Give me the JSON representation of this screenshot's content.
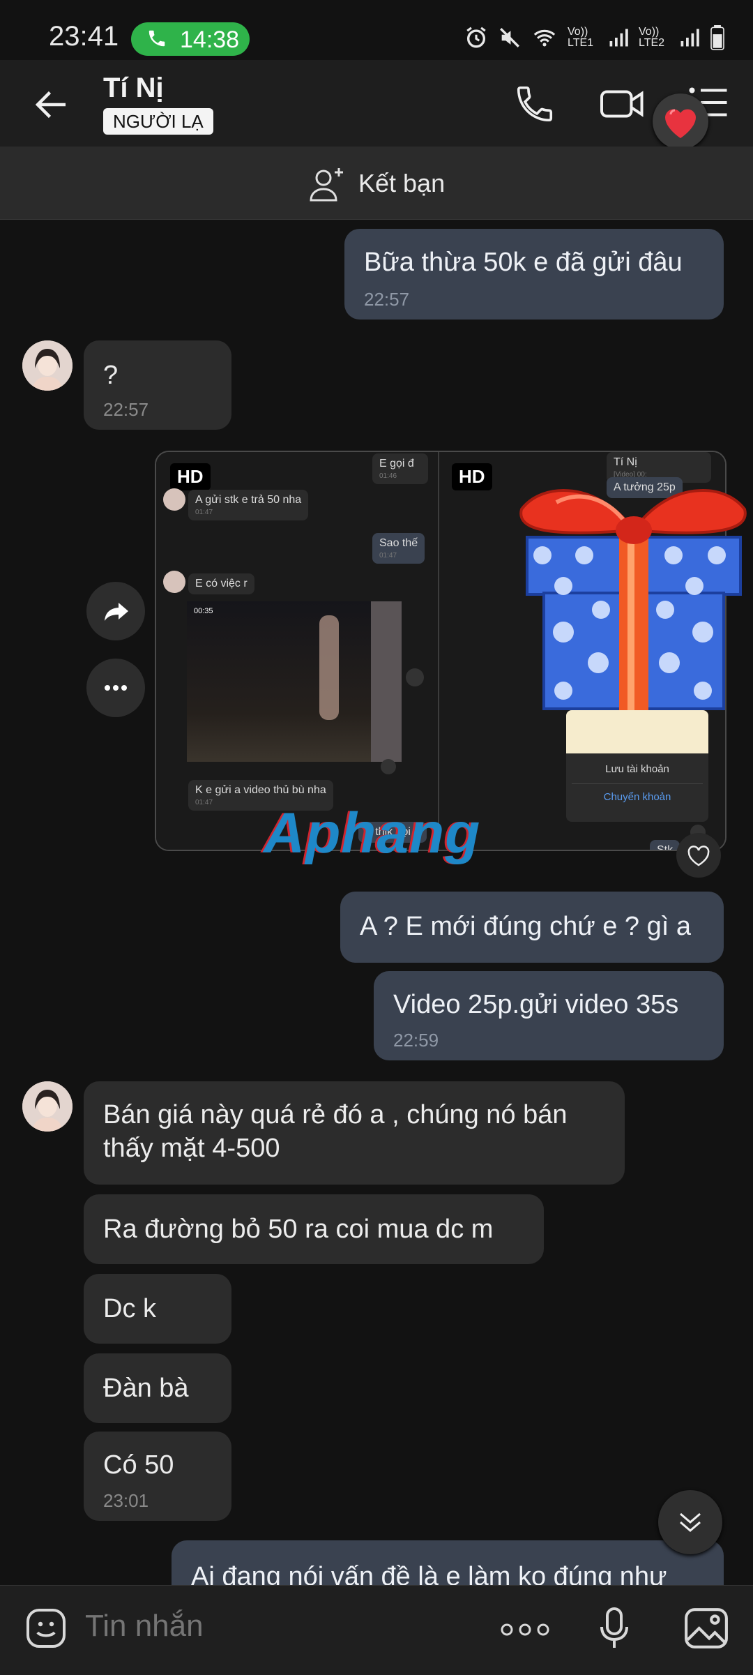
{
  "status": {
    "clock": "23:41",
    "call_timer": "14:38",
    "net1": "Vo)) LTE1",
    "net2": "Vo)) LTE2"
  },
  "header": {
    "name": "Tí Nị",
    "badge": "NGƯỜI LẠ"
  },
  "add_friend": {
    "label": "Kết bạn"
  },
  "messages": {
    "m1": {
      "text": "Bữa thừa 50k e đã gửi đâu",
      "time": "22:57"
    },
    "m2": {
      "text": "?",
      "time": "22:57"
    },
    "m3": {
      "text": "A ? E mới đúng chứ e ? gì a"
    },
    "m4": {
      "text": "Video 25p.gửi video 35s",
      "time": "22:59"
    },
    "m5": {
      "text": "Bán giá này quá rẻ đó a , chúng nó bán thấy mặt 4-500"
    },
    "m6": {
      "text": "Ra đường bỏ 50 ra coi mua dc m"
    },
    "m7": {
      "text": "Dc k"
    },
    "m8": {
      "text": "Đàn bà"
    },
    "m9": {
      "text": "Có 50",
      "time": "23:01"
    },
    "m10": {
      "text": "Ai đang nói vấn đề là e làm ko đúng như"
    }
  },
  "media": {
    "hd_label": "HD",
    "left": {
      "e_goi": "E gọi đ",
      "e_goi_t": "01:46",
      "gui_stk": "A gửi stk  e trả 50 nha",
      "gui_stk_t": "01:47",
      "sao_the": "Sao thế",
      "sao_the_t": "01:47",
      "co_viec": "E có việc r",
      "video_len": "00:35",
      "k_gui": "K e gửi a video thủ bù nha",
      "k_gui_t": "01:47",
      "thik": "A thik gọi à"
    },
    "right": {
      "ti_ni": "Tí Nị",
      "video_tag": "[Video] 00:",
      "a_tuong": "A tưởng 25p",
      "luu": "Lưu tài khoản",
      "chuyen": "Chuyển khoản",
      "stk": "Stk"
    }
  },
  "watermark": "Aphang",
  "composer": {
    "placeholder": "Tin nhắn"
  }
}
